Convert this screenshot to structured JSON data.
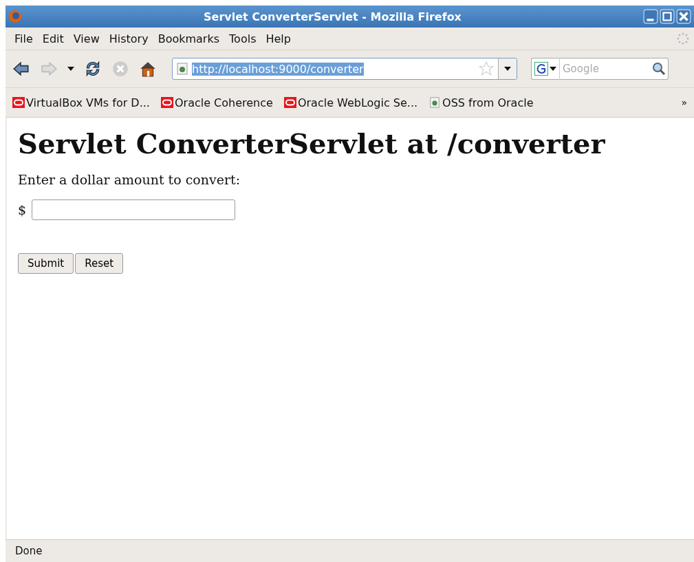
{
  "window": {
    "title": "Servlet ConverterServlet - Mozilla Firefox"
  },
  "menu": [
    "File",
    "Edit",
    "View",
    "History",
    "Bookmarks",
    "Tools",
    "Help"
  ],
  "address": {
    "url": "http://localhost:9000/converter",
    "selected": true
  },
  "search": {
    "placeholder": "Google"
  },
  "bookmarks": [
    {
      "label": "VirtualBox VMs for D...",
      "kind": "oracle"
    },
    {
      "label": "Oracle Coherence",
      "kind": "oracle"
    },
    {
      "label": "Oracle WebLogic Se...",
      "kind": "oracle"
    },
    {
      "label": "OSS from Oracle",
      "kind": "page"
    }
  ],
  "bookmarks_overflow": "»",
  "page": {
    "heading": "Servlet ConverterServlet at /converter",
    "prompt": "Enter a dollar amount to convert:",
    "currency": "$",
    "buttons": [
      "Submit",
      "Reset"
    ]
  },
  "status_bar": "Done"
}
